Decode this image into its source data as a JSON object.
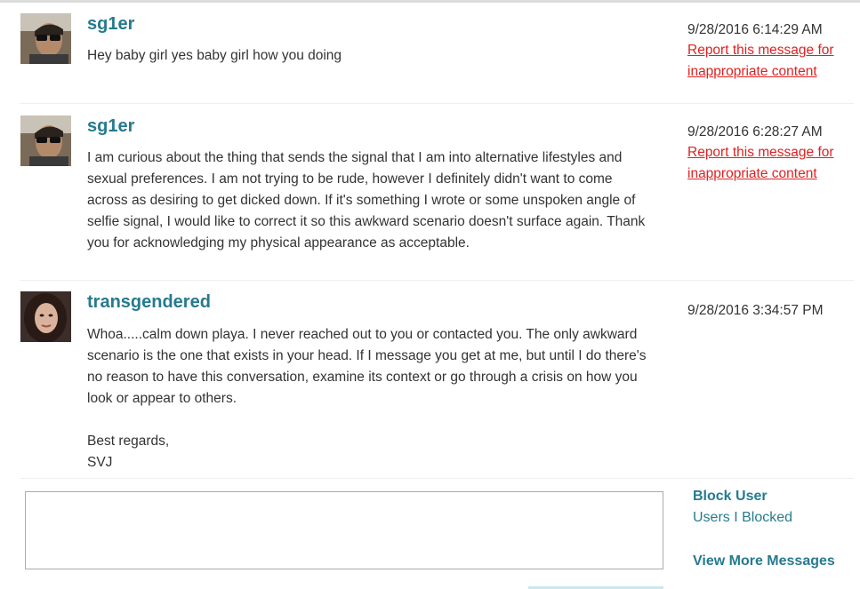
{
  "messages": [
    {
      "username": "sg1er",
      "timestamp": "9/28/2016 6:14:29 AM",
      "body": [
        "Hey baby girl yes baby girl how you doing"
      ],
      "report_label": "Report this message for inappropriate content",
      "avatar": "male-selfie-avatar"
    },
    {
      "username": "sg1er",
      "timestamp": "9/28/2016 6:28:27 AM",
      "body": [
        "I am curious about the thing that sends the signal that I am into alternative lifestyles and sexual preferences. I am not trying to be rude, however I definitely didn't want to come across as desiring to get dicked down. If it's something I wrote or some unspoken angle of selfie signal, I would like to correct it so this awkward scenario doesn't surface again. Thank you for acknowledging my physical appearance as acceptable."
      ],
      "report_label": "Report this message for inappropriate content",
      "avatar": "male-selfie-avatar"
    },
    {
      "username": "transgendered",
      "timestamp": "9/28/2016 3:34:57 PM",
      "body": [
        "Whoa.....calm down playa. I never reached out to you or contacted you. The only awkward scenario is the one that exists in your head. If I message you get at me, but until I do there's no reason to have this conversation, examine its context or go through a crisis on how you look or appear to others.",
        "Best regards,",
        "SVJ"
      ],
      "avatar": "female-selfie-avatar"
    }
  ],
  "reply": {
    "value": "",
    "placeholder": ""
  },
  "actions": {
    "block_user": "Block User",
    "users_blocked": "Users I Blocked",
    "view_more": "View More Messages"
  },
  "colors": {
    "username": "#267a8f",
    "report": "#e02020",
    "text": "#333333"
  }
}
